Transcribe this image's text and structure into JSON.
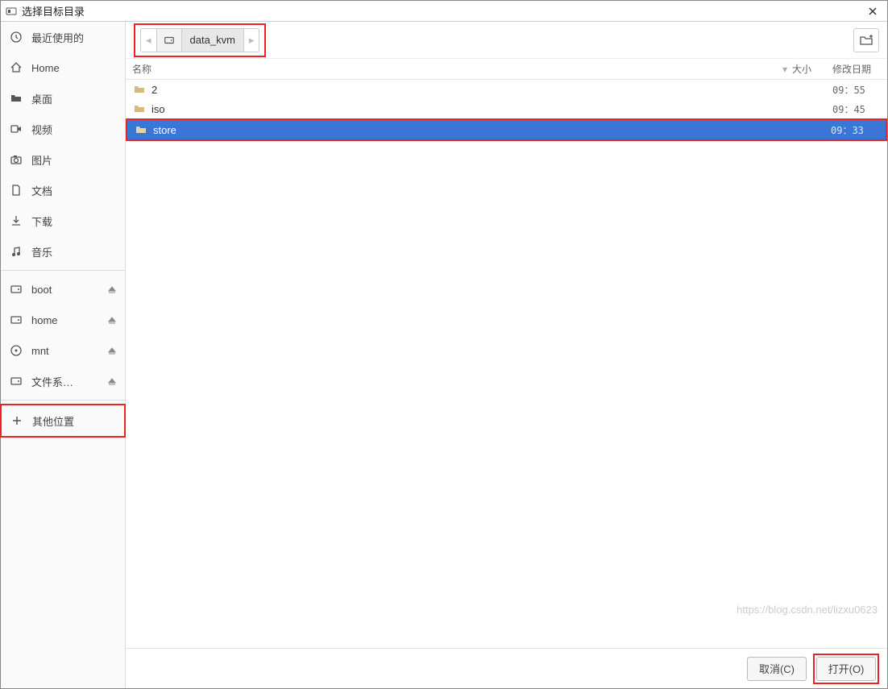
{
  "title": "选择目标目录",
  "breadcrumb": {
    "prev_enabled": false,
    "next_enabled": false,
    "current": "data_kvm"
  },
  "sidebar": {
    "places": [
      {
        "icon": "clock-icon",
        "label": "最近使用的"
      },
      {
        "icon": "home-icon",
        "label": "Home"
      },
      {
        "icon": "folder-icon",
        "label": "桌面"
      },
      {
        "icon": "video-icon",
        "label": "视频"
      },
      {
        "icon": "camera-icon",
        "label": "图片"
      },
      {
        "icon": "document-icon",
        "label": "文档"
      },
      {
        "icon": "download-icon",
        "label": "下载"
      },
      {
        "icon": "music-icon",
        "label": "音乐"
      }
    ],
    "devices": [
      {
        "icon": "drive-icon",
        "label": "boot",
        "eject": true
      },
      {
        "icon": "drive-icon",
        "label": "home",
        "eject": true
      },
      {
        "icon": "disc-icon",
        "label": "mnt",
        "eject": true
      },
      {
        "icon": "drive-icon",
        "label": "文件系…",
        "eject": true
      }
    ],
    "other_label": "其他位置"
  },
  "columns": {
    "name": "名称",
    "size": "大小",
    "date": "修改日期"
  },
  "files": [
    {
      "icon": "folder-icon",
      "name": "2",
      "size": "",
      "date": "09：55",
      "selected": false
    },
    {
      "icon": "folder-icon",
      "name": "iso",
      "size": "",
      "date": "09：45",
      "selected": false
    },
    {
      "icon": "folder-icon",
      "name": "store",
      "size": "",
      "date": "09：33",
      "selected": true
    }
  ],
  "buttons": {
    "cancel": "取消(C)",
    "open": "打开(O)"
  },
  "watermark": "https://blog.csdn.net/lizxu0623"
}
